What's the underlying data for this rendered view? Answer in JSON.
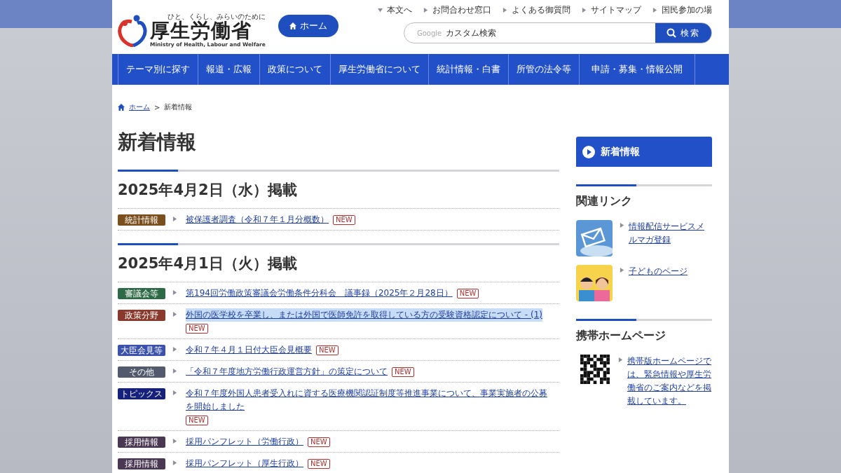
{
  "header": {
    "tagline": "ひと、くらし、みらいのために",
    "logo_text": "厚生労働省",
    "logo_subtext": "Ministry of Health, Labour and Welfare",
    "home_button": "ホーム",
    "utility_links": [
      {
        "label": "本文へ",
        "kind": "down"
      },
      {
        "label": "お問合わせ窓口",
        "kind": "right"
      },
      {
        "label": "よくある御質問",
        "kind": "right"
      },
      {
        "label": "サイトマップ",
        "kind": "right"
      },
      {
        "label": "国民参加の場",
        "kind": "right"
      }
    ],
    "search": {
      "brand": "Google",
      "placeholder": "カスタム検索",
      "button": "検索"
    }
  },
  "nav": [
    "テーマ別に探す",
    "報道・広報",
    "政策について",
    "厚生労働省について",
    "統計情報・白書",
    "所管の法令等",
    "申請・募集・情報公開"
  ],
  "breadcrumb": [
    "ホーム",
    "新着情報"
  ],
  "breadcrumb_separator": ">",
  "page_title": "新着情報",
  "sections": [
    {
      "date": "2025年4月2日（水）掲載",
      "items": [
        {
          "tag": "統計情報",
          "color": "#7a4f1d",
          "title": "被保護者調査（令和７年１月分概数）",
          "badge": "NEW",
          "highlighted": false
        }
      ]
    },
    {
      "date": "2025年4月1日（火）掲載",
      "items": [
        {
          "tag": "審議会等",
          "color": "#2f6a47",
          "title": "第194回労働政策審議会労働条件分科会　議事録（2025年２月28日）",
          "badge": "NEW",
          "highlighted": false
        },
        {
          "tag": "政策分野",
          "color": "#8a3a2c",
          "title": "外国の医学校を卒業し、または外国で医師免許を取得している方の受験資格認定について - (1)",
          "badge": "NEW",
          "highlighted": true
        },
        {
          "tag": "大臣会見等",
          "color": "#3a51ad",
          "title": "令和７年４月１日付大臣会見概要",
          "badge": "NEW",
          "highlighted": false
        },
        {
          "tag": "その他",
          "color": "#545a6d",
          "title": "「令和７年度地方労働行政運営方針」の策定について",
          "badge": "NEW",
          "highlighted": false
        },
        {
          "tag": "トピックス",
          "color": "#15217a",
          "title": "令和７年度外国人患者受入れに資する医療機関認証制度等推進事業について、事業実施者の公募を開始しました",
          "badge": "NEW",
          "highlighted": false
        },
        {
          "tag": "採用情報",
          "color": "#4a3852",
          "title": "採用パンフレット（労働行政）",
          "badge": "NEW",
          "highlighted": false
        },
        {
          "tag": "採用情報",
          "color": "#4a3852",
          "title": "採用パンフレット（厚生行政）",
          "badge": "NEW",
          "highlighted": false
        }
      ]
    }
  ],
  "sidebar": {
    "current": "新着情報",
    "related": {
      "heading": "関連リンク",
      "links": [
        {
          "label": "情報配信サービスメルマガ登録",
          "kind": "mail"
        },
        {
          "label": "子どものページ",
          "kind": "kids"
        }
      ]
    },
    "mobile": {
      "heading": "携帯ホームページ",
      "text": "携帯版ホームページでは、緊急情報や厚生労働省のご案内などを掲載しています。"
    }
  }
}
